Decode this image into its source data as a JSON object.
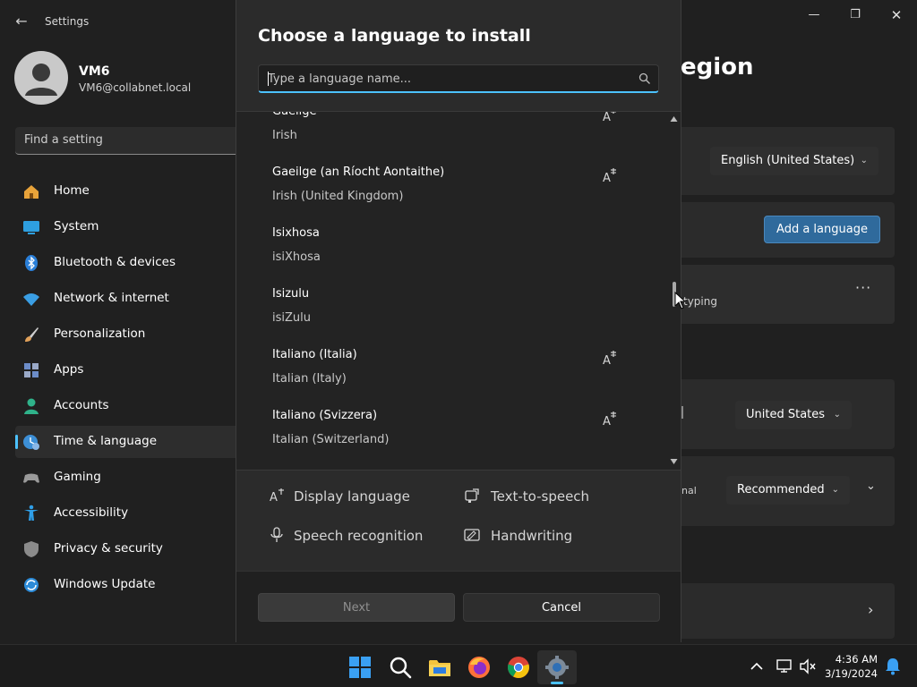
{
  "window": {
    "title": "Settings",
    "back_icon": "back-arrow-icon",
    "minimize_icon": "minimize-icon",
    "maximize_icon": "restore-icon",
    "close_icon": "close-icon"
  },
  "profile": {
    "name": "VM6",
    "email": "VM6@collabnet.local"
  },
  "search": {
    "placeholder": "Find a setting"
  },
  "nav": [
    {
      "label": "Home",
      "icon": "home-icon",
      "color": "#e8a33a"
    },
    {
      "label": "System",
      "icon": "system-icon",
      "color": "#2e9fe0"
    },
    {
      "label": "Bluetooth & devices",
      "icon": "bluetooth-icon",
      "color": "#2a7fd8"
    },
    {
      "label": "Network & internet",
      "icon": "wifi-icon",
      "color": "#3a9ee4"
    },
    {
      "label": "Personalization",
      "icon": "brush-icon",
      "color": "#e1a15a"
    },
    {
      "label": "Apps",
      "icon": "apps-icon",
      "color": "#6c8cc8"
    },
    {
      "label": "Accounts",
      "icon": "accounts-icon",
      "color": "#2fb28a"
    },
    {
      "label": "Time & language",
      "icon": "time-language-icon",
      "color": "#3d8fd6",
      "selected": true
    },
    {
      "label": "Gaming",
      "icon": "gaming-icon",
      "color": "#9a9a9a"
    },
    {
      "label": "Accessibility",
      "icon": "accessibility-icon",
      "color": "#2f9fe8"
    },
    {
      "label": "Privacy & security",
      "icon": "shield-icon",
      "color": "#8b8b8b"
    },
    {
      "label": "Windows Update",
      "icon": "update-icon",
      "color": "#2c8bd8"
    }
  ],
  "background": {
    "page_title_visible": "egion",
    "windows_display_language": "English (United States)",
    "add_language": "Add a language",
    "typing_fragment": "typing",
    "country_value": "United States",
    "regional_fragment": "nal",
    "regional_format": "Recommended"
  },
  "dialog": {
    "title": "Choose a language to install",
    "search_placeholder": "Type a language name...",
    "languages": [
      {
        "name": "Gaeilge",
        "translation": "Irish",
        "display_lang": true
      },
      {
        "name": "Gaeilge (an Ríocht Aontaithe)",
        "translation": "Irish (United Kingdom)",
        "display_lang": true
      },
      {
        "name": "Isixhosa",
        "translation": "isiXhosa",
        "display_lang": false
      },
      {
        "name": "Isizulu",
        "translation": "isiZulu",
        "display_lang": false
      },
      {
        "name": "Italiano (Italia)",
        "translation": "Italian (Italy)",
        "display_lang": true
      },
      {
        "name": "Italiano (Svizzera)",
        "translation": "Italian (Switzerland)",
        "display_lang": true
      }
    ],
    "features": {
      "display_language": "Display language",
      "text_to_speech": "Text-to-speech",
      "speech_recognition": "Speech recognition",
      "handwriting": "Handwriting"
    },
    "next": "Next",
    "cancel": "Cancel"
  },
  "taskbar": {
    "apps": [
      "windows-start-icon",
      "search-icon",
      "file-explorer-icon",
      "firefox-icon",
      "chrome-icon",
      "settings-icon"
    ],
    "time": "4:36 AM",
    "date": "3/19/2024"
  },
  "colors": {
    "accent": "#4cc2ff",
    "button_primary": "#2f6a9c"
  }
}
